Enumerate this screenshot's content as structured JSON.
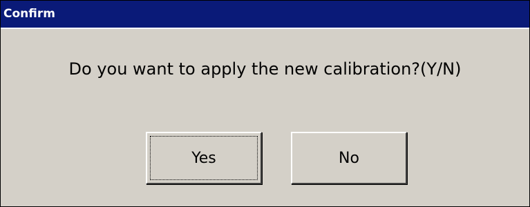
{
  "dialog": {
    "title": "Confirm",
    "message": "Do you want to apply the new calibration?(Y/N)",
    "buttons": {
      "yes_label": "Yes",
      "no_label": "No"
    },
    "focused_button": "yes"
  },
  "colors": {
    "titlebar": "#0a1a78",
    "title_text": "#ffffff",
    "dialog_background": "#d4d0c8",
    "text": "#000000"
  }
}
